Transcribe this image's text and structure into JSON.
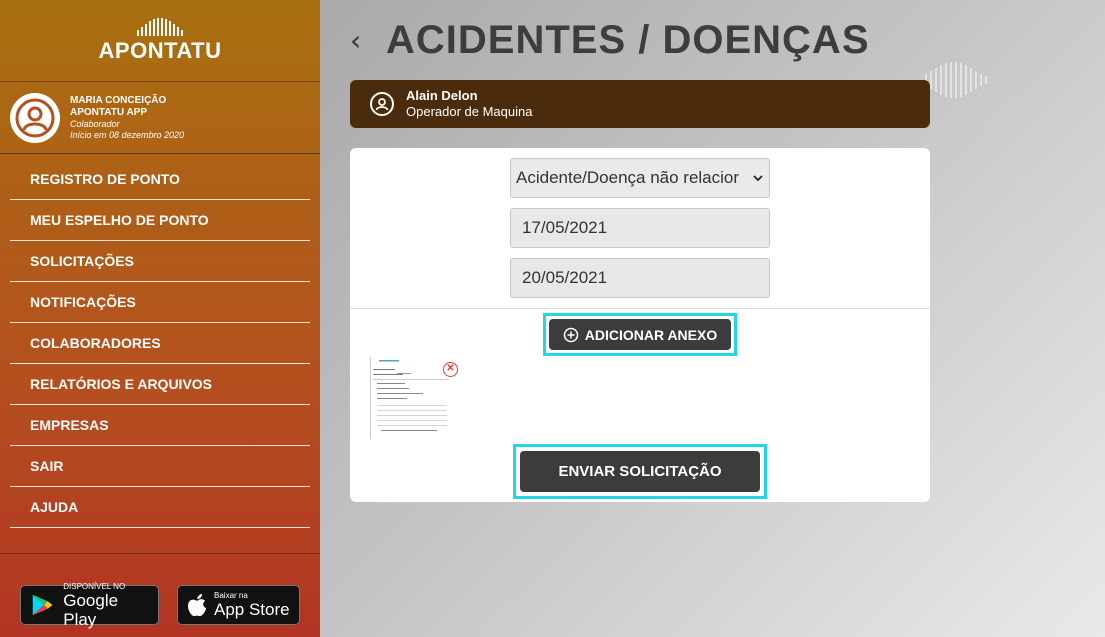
{
  "brand": {
    "name": "APONTATU"
  },
  "user": {
    "name": "MARIA CONCEIçãO",
    "company": "APONTATU APP",
    "role": "Colaborador",
    "since": "Início em 08 dezembro 2020"
  },
  "menu": [
    {
      "label": "REGISTRO DE PONTO"
    },
    {
      "label": "MEU ESPELHO DE PONTO"
    },
    {
      "label": "SOLICITAÇÕES"
    },
    {
      "label": "NOTIFICAÇÕES"
    },
    {
      "label": "COLABORADORES"
    },
    {
      "label": "RELATÓRIOS E ARQUIVOS"
    },
    {
      "label": "EMPRESAS"
    },
    {
      "label": "SAIR"
    },
    {
      "label": "AJUDA"
    }
  ],
  "stores": {
    "google": {
      "small": "DISPONÍVEL NO",
      "big": "Google Play"
    },
    "apple": {
      "small": "Baixar na",
      "big": "App Store"
    }
  },
  "page": {
    "back_icon": "chevron-left-icon",
    "title": "ACIDENTES / DOENÇAS"
  },
  "employee": {
    "name": "Alain Delon",
    "role": "Operador de Maquina"
  },
  "form": {
    "type_value": "Acidente/Doença não relacior",
    "start_date": "17/05/2021",
    "end_date": "20/05/2021",
    "add_attachment_label": "ADICIONAR ANEXO",
    "submit_label": "ENVIAR SOLICITAÇÃO"
  },
  "colors": {
    "sidebar_top": "#a8700f",
    "sidebar_bottom": "#b23423",
    "employee_bar": "#4a2b0b",
    "button_dark": "#3c3c3c",
    "highlight": "#22d6e6"
  }
}
